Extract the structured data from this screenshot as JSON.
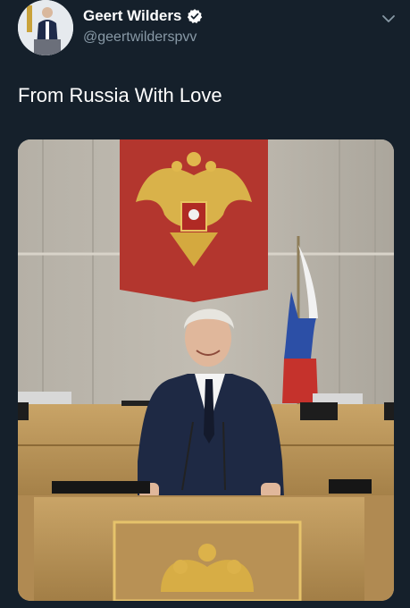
{
  "tweet": {
    "author": {
      "display_name": "Geert Wilders",
      "handle": "@geertwilderspvv",
      "verified": true,
      "avatar_icon": "person-at-podium-avatar"
    },
    "text": "From Russia With Love",
    "menu_icon": "chevron-down-icon",
    "media": {
      "alt": "Man standing at a podium in the Russian State Duma with the Russian coat of arms and flag behind him"
    }
  },
  "colors": {
    "background": "#15202b",
    "verified_blue": "#1da1f2",
    "secondary_text": "#8899a6"
  }
}
